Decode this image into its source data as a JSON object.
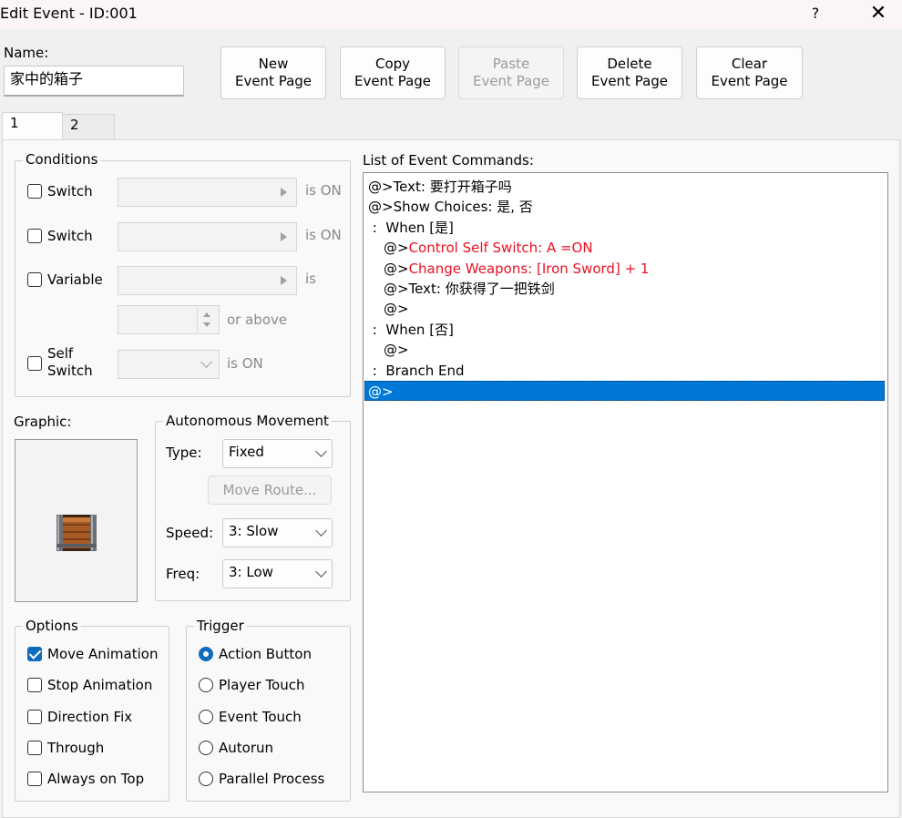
{
  "window": {
    "title": "Edit Event - ID:001",
    "help_label": "?",
    "close_label": "✕"
  },
  "name": {
    "label": "Name:",
    "value": "家中的箱子"
  },
  "toolbar": {
    "new": [
      "New",
      "Event Page"
    ],
    "copy": [
      "Copy",
      "Event Page"
    ],
    "paste": [
      "Paste",
      "Event Page"
    ],
    "delete": [
      "Delete",
      "Event Page"
    ],
    "clear": [
      "Clear",
      "Event Page"
    ]
  },
  "tabs": [
    "1",
    "2"
  ],
  "conditions": {
    "legend": "Conditions",
    "switch1": {
      "label": "Switch",
      "suffix": "is ON",
      "checked": false
    },
    "switch2": {
      "label": "Switch",
      "suffix": "is ON",
      "checked": false
    },
    "variable": {
      "label": "Variable",
      "suffix": "is",
      "checked": false
    },
    "or_above": "or above",
    "self_switch": {
      "label_line1": "Self",
      "label_line2": "Switch",
      "suffix": "is ON",
      "checked": false
    }
  },
  "graphic": {
    "label": "Graphic:",
    "icon": "treasure-chest-icon"
  },
  "autonomous": {
    "legend": "Autonomous Movement",
    "type_label": "Type:",
    "type_value": "Fixed",
    "move_route_label": "Move Route...",
    "speed_label": "Speed:",
    "speed_value": "3: Slow",
    "freq_label": "Freq:",
    "freq_value": "3: Low"
  },
  "options": {
    "legend": "Options",
    "items": [
      {
        "label": "Move Animation",
        "checked": true
      },
      {
        "label": "Stop Animation",
        "checked": false
      },
      {
        "label": "Direction Fix",
        "checked": false
      },
      {
        "label": "Through",
        "checked": false
      },
      {
        "label": "Always on Top",
        "checked": false
      }
    ]
  },
  "trigger": {
    "legend": "Trigger",
    "items": [
      {
        "label": "Action Button",
        "selected": true
      },
      {
        "label": "Player Touch",
        "selected": false
      },
      {
        "label": "Event Touch",
        "selected": false
      },
      {
        "label": "Autorun",
        "selected": false
      },
      {
        "label": "Parallel Process",
        "selected": false
      }
    ]
  },
  "commands": {
    "label": "List of Event Commands:",
    "items": [
      {
        "prefix": "@>Text: ",
        "body": "要打开箱子吗",
        "red": false,
        "indent": 0
      },
      {
        "prefix": "@>Show Choices: ",
        "body": "是, 否",
        "red": false,
        "indent": 0
      },
      {
        "prefix": " :  When ",
        "body": "[是]",
        "red": false,
        "indent": 0
      },
      {
        "prefix": "@>",
        "body": "Control Self Switch: A =ON",
        "red": true,
        "indent": 1
      },
      {
        "prefix": "@>",
        "body": "Change Weapons: [Iron Sword] + 1",
        "red": true,
        "indent": 1
      },
      {
        "prefix": "@>Text: ",
        "body": "你获得了一把铁剑",
        "red": false,
        "indent": 1
      },
      {
        "prefix": "@>",
        "body": "",
        "red": false,
        "indent": 1
      },
      {
        "prefix": " :  When ",
        "body": "[否]",
        "red": false,
        "indent": 0
      },
      {
        "prefix": "@>",
        "body": "",
        "red": false,
        "indent": 1
      },
      {
        "prefix": " :  Branch End",
        "body": "",
        "red": false,
        "indent": 0
      },
      {
        "prefix": "@>",
        "body": "",
        "red": false,
        "indent": 0,
        "selected": true
      }
    ]
  },
  "colors": {
    "accent": "#0078d7",
    "command_red": "#e81123",
    "checkbox_blue": "#0f6cbd"
  }
}
